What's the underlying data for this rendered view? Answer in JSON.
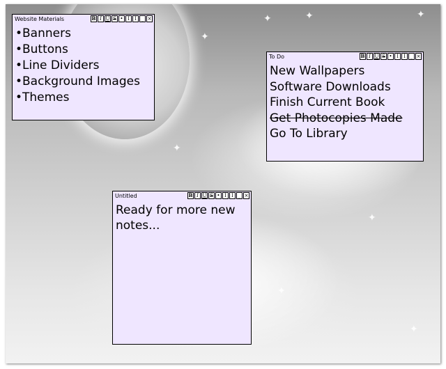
{
  "desktop": {
    "background_colors": [
      "#8e8e8e",
      "#d2d2d2",
      "#f2f2f2"
    ]
  },
  "note_colors": {
    "background": "#efe6ff",
    "border": "#000000"
  },
  "toolbar_buttons": [
    "B",
    "I",
    "U",
    "S",
    "•",
    "I",
    "I",
    "_",
    "×"
  ],
  "notes": [
    {
      "title": "Website Materials",
      "items": [
        "Banners",
        "Buttons",
        "Line Dividers",
        "Background Images",
        "Themes"
      ]
    },
    {
      "title": "To Do",
      "lines": [
        "New Wallpapers",
        "Software Downloads",
        "Finish Current Book",
        "Get Photocopies Made",
        "Go To Library"
      ],
      "struck_line_index": 3
    },
    {
      "title": "Untitled",
      "text": "Ready for more new notes..."
    }
  ]
}
